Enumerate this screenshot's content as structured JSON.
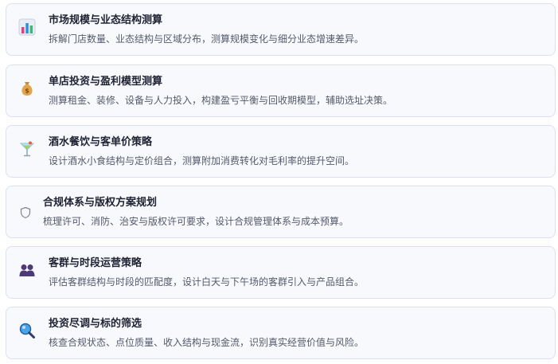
{
  "cards": [
    {
      "icon": "bar-chart-icon",
      "title": "市场规模与业态结构测算",
      "desc": "拆解门店数量、业态结构与区域分布，测算规模变化与细分业态增速差异。"
    },
    {
      "icon": "money-bag-icon",
      "title": "单店投资与盈利模型测算",
      "desc": "测算租金、装修、设备与人力投入，构建盈亏平衡与回收期模型，辅助选址决策。"
    },
    {
      "icon": "cocktail-icon",
      "title": "酒水餐饮与客单价策略",
      "desc": "设计酒水小食结构与定价组合，测算附加消费转化对毛利率的提升空间。"
    },
    {
      "icon": "shield-icon",
      "title": "合规体系与版权方案规划",
      "desc": "梳理许可、消防、治安与版权许可要求，设计合规管理体系与成本预算。"
    },
    {
      "icon": "people-icon",
      "title": "客群与时段运营策略",
      "desc": "评估客群结构与时段的匹配度，设计白天与下午场的客群引入与产品组合。"
    },
    {
      "icon": "magnifier-icon",
      "title": "投资尽调与标的筛选",
      "desc": "核查合规状态、点位质量、收入结构与现金流，识别真实经营价值与风险。"
    }
  ]
}
